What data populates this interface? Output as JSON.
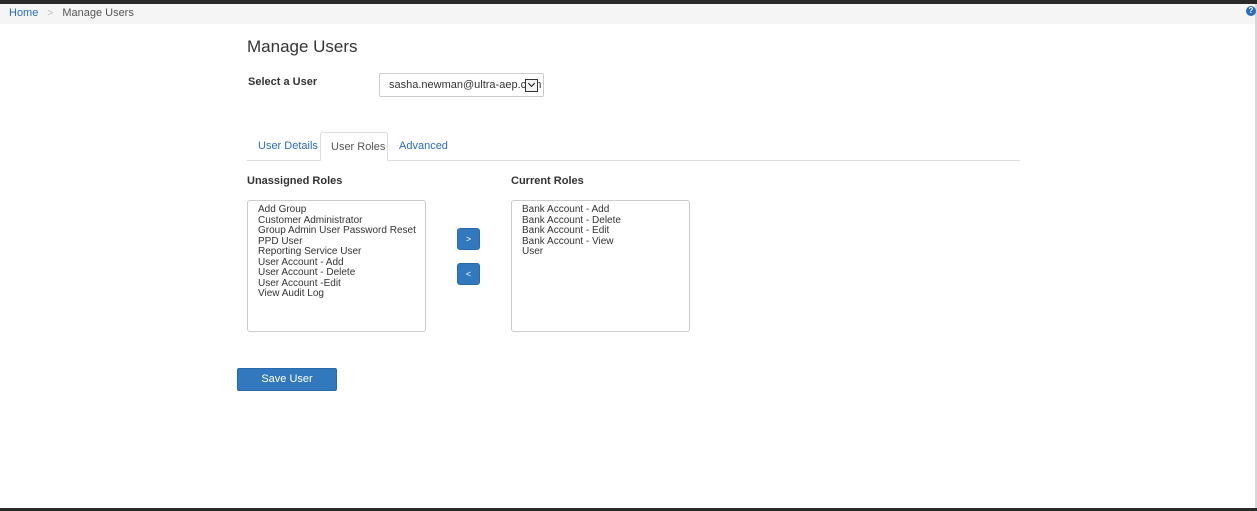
{
  "breadcrumb": {
    "home_label": "Home",
    "separator": ">",
    "current_label": "Manage Users"
  },
  "help_icon_glyph": "?",
  "page": {
    "title": "Manage Users",
    "select_user_label": "Select a User",
    "selected_user": "sasha.newman@ultra-aep.com"
  },
  "tabs": [
    {
      "label": "User Details",
      "active": false
    },
    {
      "label": "User Roles",
      "active": true
    },
    {
      "label": "Advanced",
      "active": false
    }
  ],
  "roles": {
    "unassigned_label": "Unassigned Roles",
    "current_label": "Current Roles",
    "unassigned": [
      "Add Group",
      "Customer Administrator",
      "Group Admin User Password Reset",
      "PPD User",
      "Reporting Service User",
      "User Account - Add",
      "User Account - Delete",
      "User Account -Edit",
      "View Audit Log"
    ],
    "current": [
      "Bank Account - Add",
      "Bank Account - Delete",
      "Bank Account - Edit",
      "Bank Account - View",
      "User"
    ],
    "move_right_label": ">",
    "move_left_label": "<"
  },
  "actions": {
    "save_label": "Save User"
  },
  "colors": {
    "accent": "#3278bd",
    "link": "#2a6cbd"
  }
}
